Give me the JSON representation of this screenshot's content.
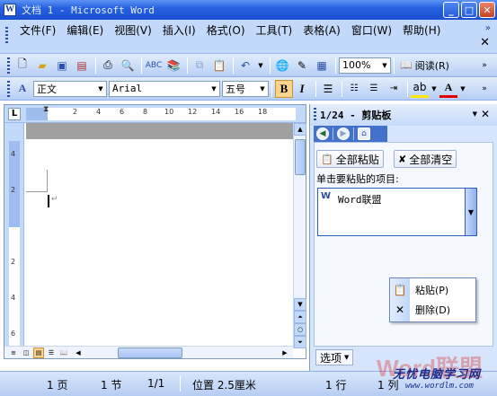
{
  "window": {
    "title": "文档 1 - Microsoft Word"
  },
  "menu": [
    "文件(F)",
    "编辑(E)",
    "视图(V)",
    "插入(I)",
    "格式(O)",
    "工具(T)",
    "表格(A)",
    "窗口(W)",
    "帮助(H)"
  ],
  "toolbar": {
    "zoom": "100%",
    "read": "阅读(R)"
  },
  "formatting": {
    "style": "正文",
    "font": "Arial",
    "size": "五号",
    "bold": "B",
    "italic": "I"
  },
  "ruler": {
    "h_numbers": [
      "2",
      "4",
      "6",
      "8",
      "10",
      "12",
      "14",
      "16",
      "18"
    ],
    "v_numbers": [
      "4",
      "2",
      "2",
      "4",
      "6"
    ]
  },
  "clipboard_pane": {
    "title": "1/24 - 剪贴板",
    "paste_all": "全部粘贴",
    "clear_all": "全部清空",
    "hint": "单击要粘贴的项目:",
    "items": [
      {
        "text": "Word联盟"
      }
    ],
    "context_menu": [
      "粘贴(P)",
      "删除(D)"
    ],
    "options": "选项"
  },
  "statusbar": {
    "page": "1 页",
    "section": "1 节",
    "page_of": "1/1",
    "position": "位置 2.5厘米",
    "line": "1 行",
    "column": "1 列"
  },
  "watermark": {
    "brand": "Word联盟",
    "slogan": "无忧电脑学习网",
    "url": "www.wordlm.com"
  }
}
